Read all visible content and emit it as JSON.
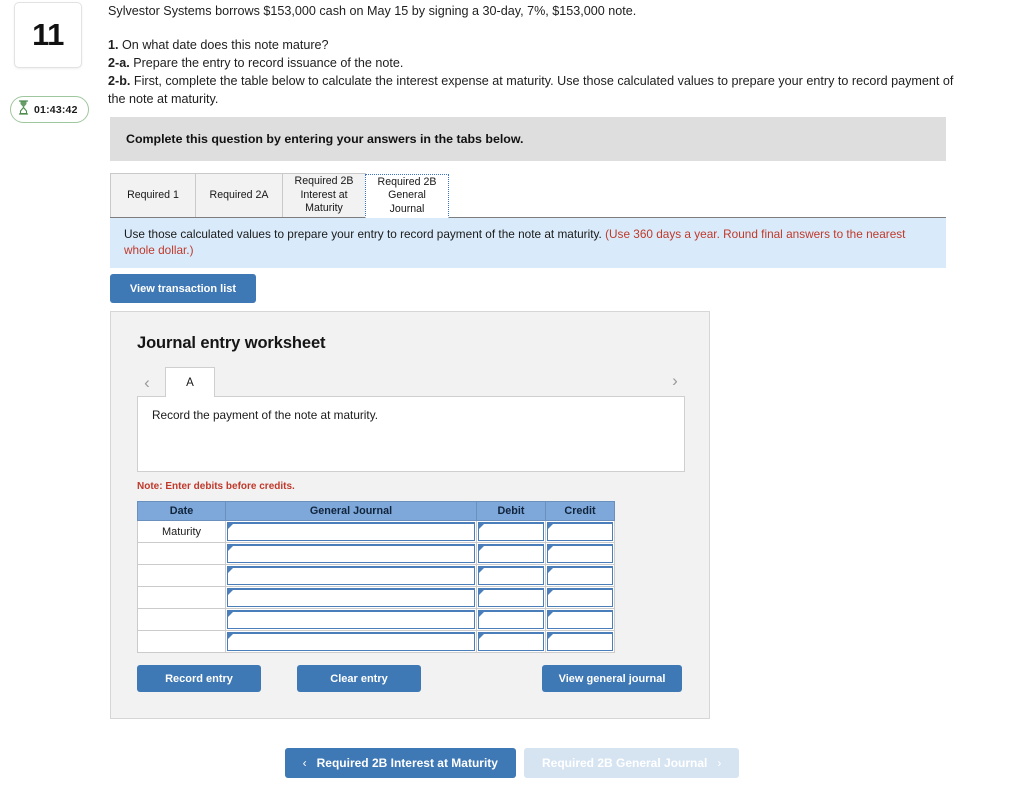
{
  "question_number": "11",
  "timer": {
    "icon": "hourglass-icon",
    "value": "01:43:42"
  },
  "prompt": {
    "lead": "Sylvestor Systems borrows $153,000 cash on May 15 by signing a 30-day, 7%, $153,000 note.",
    "req1_label": "1.",
    "req1_text": " On what date does this note mature?",
    "req2a_label": "2-a.",
    "req2a_text": " Prepare the entry to record issuance of the note.",
    "req2b_label": "2-b.",
    "req2b_text": " First, complete the table below to calculate the interest expense at maturity. Use those calculated values to prepare your entry to record payment of the note at maturity."
  },
  "complete_bar": {
    "text": "Complete this question by entering your answers in the tabs below."
  },
  "tabs": [
    {
      "label": "Required 1",
      "active": false
    },
    {
      "label": "Required 2A",
      "active": false
    },
    {
      "label": "Required 2B Interest at Maturity",
      "active": false
    },
    {
      "label": "Required 2B General Journal",
      "active": true
    }
  ],
  "instruction_strip": {
    "text": "Use those calculated values to prepare your entry to record payment of the note at maturity. ",
    "hint": "(Use 360 days a year. Round final answers to the nearest whole dollar.)",
    "hint_color": "#c0392b"
  },
  "view_transaction_list_label": "View transaction list",
  "worksheet": {
    "title": "Journal entry worksheet",
    "prev_chevron": "chevron-left-icon",
    "next_chevron": "chevron-right-icon",
    "entry_tabs": [
      {
        "label": "A",
        "active": true
      }
    ],
    "description": "Record the payment of the note at maturity.",
    "note": "Note: Enter debits before credits.",
    "table": {
      "headers": [
        "Date",
        "General Journal",
        "Debit",
        "Credit"
      ],
      "rows": [
        {
          "date": "Maturity",
          "general_journal": "",
          "debit": "",
          "credit": ""
        },
        {
          "date": "",
          "general_journal": "",
          "debit": "",
          "credit": ""
        },
        {
          "date": "",
          "general_journal": "",
          "debit": "",
          "credit": ""
        },
        {
          "date": "",
          "general_journal": "",
          "debit": "",
          "credit": ""
        },
        {
          "date": "",
          "general_journal": "",
          "debit": "",
          "credit": ""
        },
        {
          "date": "",
          "general_journal": "",
          "debit": "",
          "credit": ""
        }
      ]
    },
    "buttons": {
      "record_entry": "Record entry",
      "clear_entry": "Clear entry",
      "view_general_journal": "View general journal"
    }
  },
  "bottom_nav": {
    "prev_chevron": "‹",
    "prev_label": "Required 2B Interest at Maturity",
    "next_label": "Required 2B General Journal",
    "next_chevron": "›"
  },
  "colors": {
    "primary_blue": "#3e78b5",
    "table_header_blue": "#7fa8da",
    "instruction_blue": "#d9ebfa",
    "gray_bar": "#dedede",
    "accent_red": "#c0392b",
    "timer_green": "#4e8c4e"
  }
}
